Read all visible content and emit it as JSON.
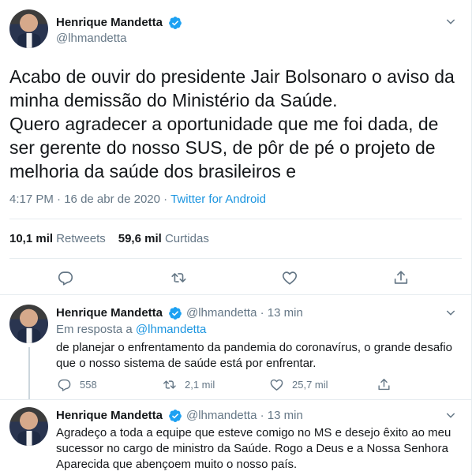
{
  "main_tweet": {
    "author_name": "Henrique Mandetta",
    "handle": "@lhmandetta",
    "text_paragraphs": [
      "Acabo de ouvir do presidente Jair Bolsonaro o aviso da minha demissão do Ministério da Saúde.",
      "Quero agradecer a oportunidade que me foi dada, de ser gerente do nosso SUS, de pôr de pé o projeto de melhoria da saúde dos brasileiros e"
    ],
    "time": "4:17 PM",
    "dot": "·",
    "date": "16 de abr de 2020",
    "source": "Twitter for Android",
    "retweets_count": "10,1 mil",
    "retweets_label": "Retweets",
    "likes_count": "59,6 mil",
    "likes_label": "Curtidas"
  },
  "replies": [
    {
      "author_name": "Henrique Mandetta",
      "handle": "@lhmandetta",
      "dot": "·",
      "time_ago": "13 min",
      "reply_to_prefix": "Em resposta a",
      "reply_to_handle": "@lhmandetta",
      "text": "de planejar o enfrentamento da pandemia do coronavírus, o grande desafio que o nosso sistema de saúde está por enfrentar.",
      "reply_count": "558",
      "retweet_count": "2,1 mil",
      "like_count": "25,7 mil"
    },
    {
      "author_name": "Henrique Mandetta",
      "handle": "@lhmandetta",
      "dot": "·",
      "time_ago": "13 min",
      "text": "Agradeço a toda a equipe que esteve comigo no MS e desejo êxito ao meu sucessor no cargo de ministro da Saúde. Rogo a Deus e a Nossa Senhora Aparecida que abençoem muito o nosso país."
    }
  ],
  "colors": {
    "accent": "#1da1f2",
    "link": "#1b95e0",
    "muted": "#657786",
    "text": "#14171a",
    "border": "#e6ecf0"
  },
  "icons": [
    "verified-badge-icon",
    "chevron-down-icon",
    "reply-icon",
    "retweet-icon",
    "like-icon",
    "share-icon"
  ]
}
